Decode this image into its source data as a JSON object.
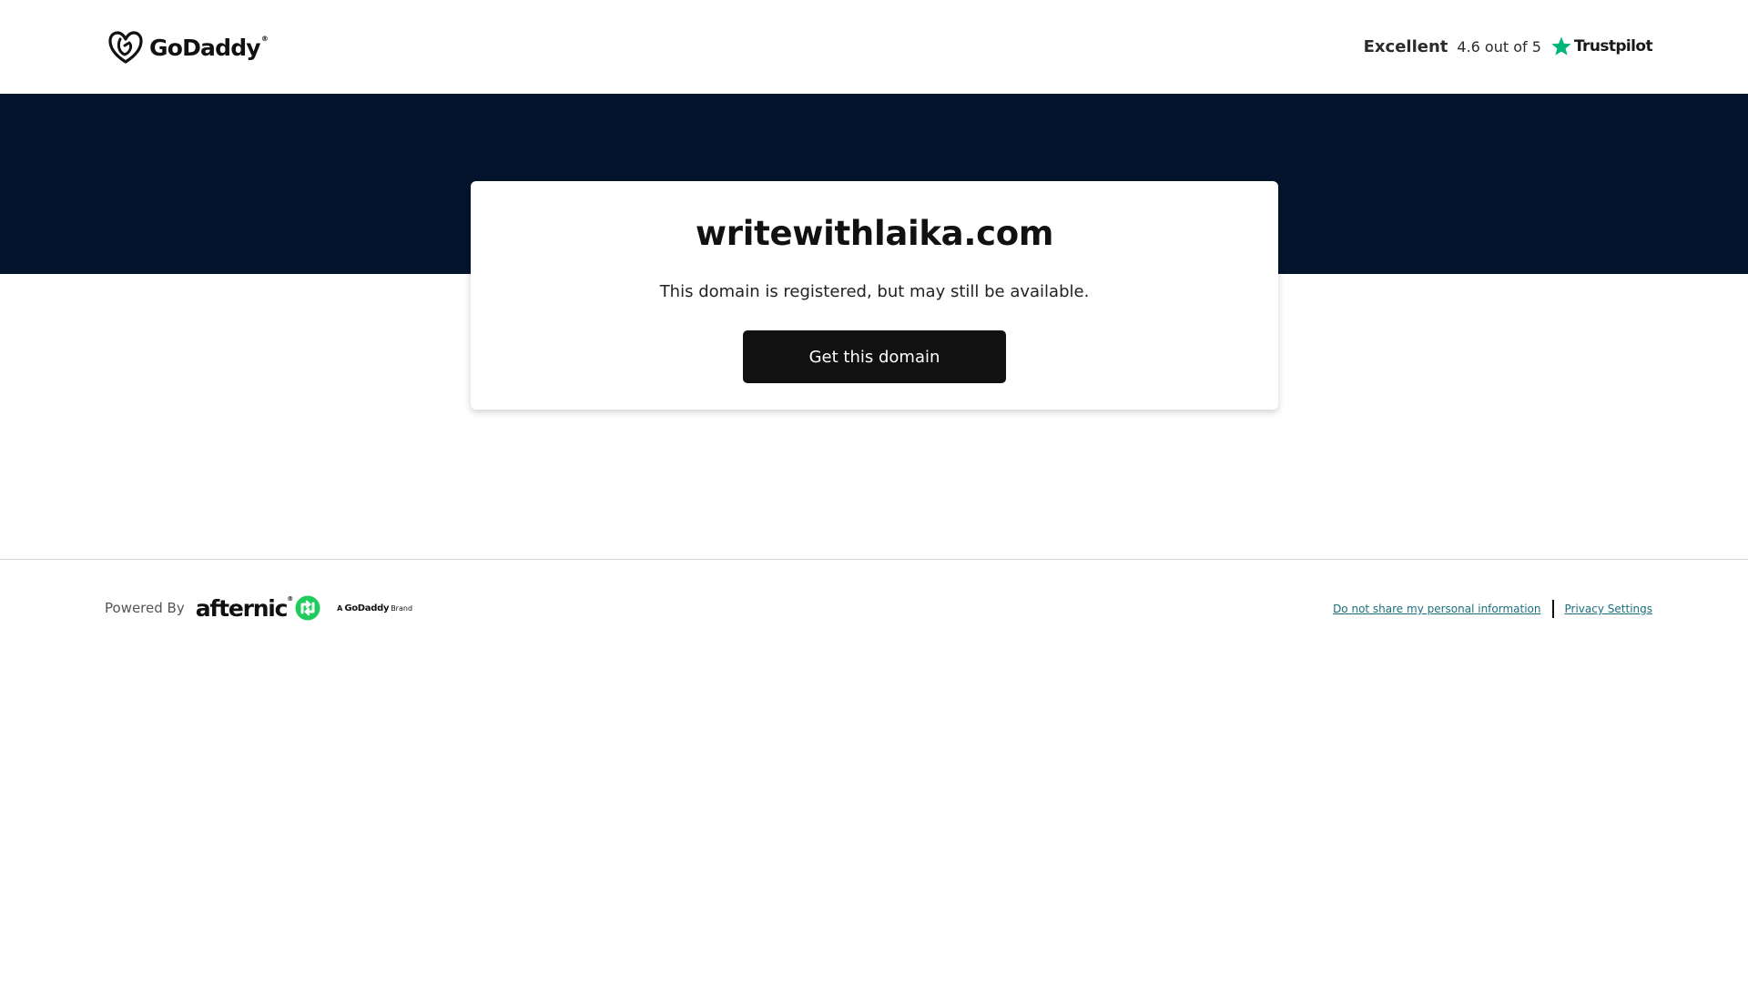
{
  "header": {
    "logo_text": "GoDaddy",
    "logo_tm": "®",
    "trustpilot": {
      "rating_word": "Excellent",
      "score_text": "4.6 out of 5",
      "brand": "Trustpilot",
      "star_color": "#00b67a"
    }
  },
  "hero": {
    "band_color": "#04142c"
  },
  "domain_card": {
    "domain_name": "writewithlaika.com",
    "status_text": "This domain is registered, but may still be available.",
    "cta_label": "Get this domain"
  },
  "footer": {
    "powered_by_label": "Powered By",
    "afternic_text": "afternic",
    "afternic_tm": "®",
    "afternic_icon_color": "#1dcc5c",
    "godaddy_brand": {
      "prefix": "A",
      "name": "GoDaddy",
      "suffix": "Brand"
    },
    "links": {
      "do_not_share": "Do not share my personal information",
      "privacy_settings": "Privacy Settings"
    },
    "link_color": "#1a6f7d"
  }
}
